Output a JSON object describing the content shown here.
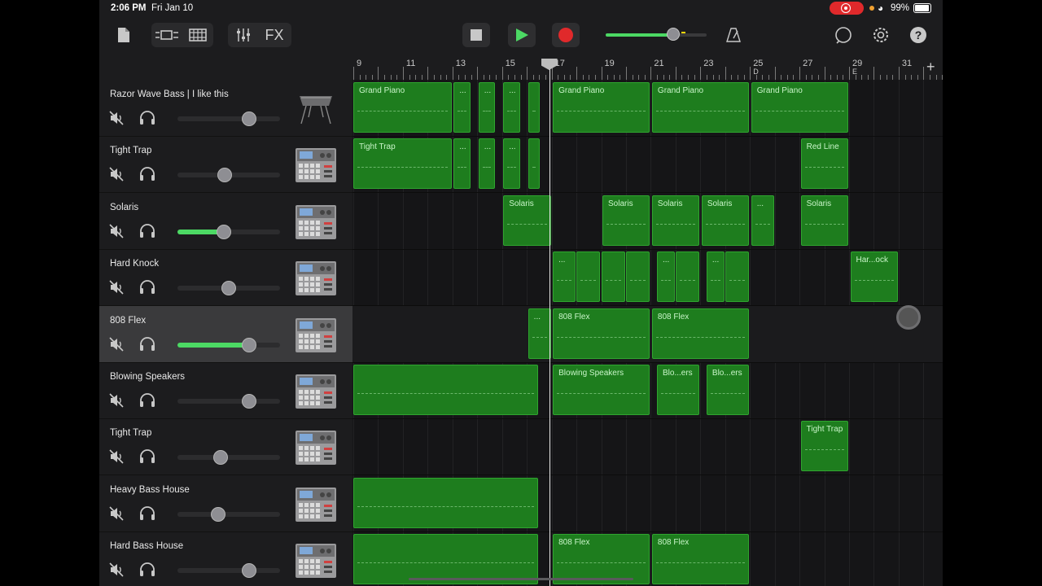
{
  "status_bar": {
    "time": "2:06 PM",
    "date": "Fri Jan 10",
    "battery": "99%"
  },
  "toolbar": {
    "fx_label": "FX",
    "master_volume": 0.42,
    "icons": [
      "document-icon",
      "track-view-icon",
      "live-loops-icon",
      "mixer-icon",
      "stop-icon",
      "play-icon",
      "record-icon",
      "metronome-icon",
      "loop-browser-icon",
      "settings-icon",
      "help-icon"
    ]
  },
  "ruler": {
    "bars": [
      "9",
      "11",
      "13",
      "15",
      "17",
      "19",
      "21",
      "23",
      "25",
      "27",
      "29",
      "31"
    ],
    "markers": [
      "D",
      "E"
    ]
  },
  "tracks": [
    {
      "name": "Razor Wave Bass | I like this",
      "volume": 0.7,
      "active": false,
      "instrument": "keyboard-icon"
    },
    {
      "name": "Tight Trap",
      "volume": 0.46,
      "active": false,
      "instrument": "drum-machine-icon"
    },
    {
      "name": "Solaris",
      "volume": 0.45,
      "active": true,
      "instrument": "drum-machine-icon"
    },
    {
      "name": "Hard Knock",
      "volume": 0.5,
      "active": false,
      "instrument": "drum-machine-icon"
    },
    {
      "name": "808 Flex",
      "volume": 0.7,
      "active": true,
      "selected": true,
      "instrument": "drum-machine-icon"
    },
    {
      "name": "Blowing Speakers",
      "volume": 0.7,
      "active": false,
      "instrument": "drum-machine-icon"
    },
    {
      "name": "Tight Trap",
      "volume": 0.42,
      "active": false,
      "instrument": "drum-machine-icon"
    },
    {
      "name": "Heavy Bass House",
      "volume": 0.4,
      "active": false,
      "instrument": "drum-machine-icon"
    },
    {
      "name": "Hard Bass House",
      "volume": 0.7,
      "active": false,
      "instrument": "drum-machine-icon"
    }
  ],
  "regions": [
    {
      "track": 0,
      "start": 9.0,
      "end": 13.0,
      "label": "Grand Piano"
    },
    {
      "track": 0,
      "start": 13.05,
      "end": 13.75,
      "label": "..."
    },
    {
      "track": 0,
      "start": 14.05,
      "end": 14.75,
      "label": "..."
    },
    {
      "track": 0,
      "start": 15.05,
      "end": 15.75,
      "label": "..."
    },
    {
      "track": 0,
      "start": 16.05,
      "end": 16.55,
      "label": ""
    },
    {
      "track": 0,
      "start": 17.05,
      "end": 21.0,
      "label": "Grand Piano"
    },
    {
      "track": 0,
      "start": 21.05,
      "end": 25.0,
      "label": "Grand Piano"
    },
    {
      "track": 0,
      "start": 25.05,
      "end": 29.0,
      "label": "Grand Piano"
    },
    {
      "track": 1,
      "start": 9.0,
      "end": 13.0,
      "label": "Tight Trap"
    },
    {
      "track": 1,
      "start": 13.05,
      "end": 13.75,
      "label": "..."
    },
    {
      "track": 1,
      "start": 14.05,
      "end": 14.75,
      "label": "..."
    },
    {
      "track": 1,
      "start": 15.05,
      "end": 15.75,
      "label": "..."
    },
    {
      "track": 1,
      "start": 16.05,
      "end": 16.55,
      "label": ""
    },
    {
      "track": 1,
      "start": 27.05,
      "end": 29.0,
      "label": "Red Line"
    },
    {
      "track": 2,
      "start": 15.05,
      "end": 17.0,
      "label": "Solaris"
    },
    {
      "track": 2,
      "start": 19.05,
      "end": 21.0,
      "label": "Solaris"
    },
    {
      "track": 2,
      "start": 21.05,
      "end": 23.0,
      "label": "Solaris"
    },
    {
      "track": 2,
      "start": 23.05,
      "end": 25.0,
      "label": "Solaris"
    },
    {
      "track": 2,
      "start": 25.05,
      "end": 26.0,
      "label": "..."
    },
    {
      "track": 2,
      "start": 27.05,
      "end": 29.0,
      "label": "Solaris"
    },
    {
      "track": 3,
      "start": 17.05,
      "end": 18.0,
      "label": "..."
    },
    {
      "track": 3,
      "start": 18.0,
      "end": 19.0,
      "label": ""
    },
    {
      "track": 3,
      "start": 19.0,
      "end": 20.0,
      "label": ""
    },
    {
      "track": 3,
      "start": 20.0,
      "end": 21.0,
      "label": ""
    },
    {
      "track": 3,
      "start": 21.25,
      "end": 22.0,
      "label": "..."
    },
    {
      "track": 3,
      "start": 22.0,
      "end": 23.0,
      "label": ""
    },
    {
      "track": 3,
      "start": 23.25,
      "end": 24.0,
      "label": "..."
    },
    {
      "track": 3,
      "start": 24.0,
      "end": 25.0,
      "label": ""
    },
    {
      "track": 3,
      "start": 29.05,
      "end": 31.0,
      "label": "Har...ock"
    },
    {
      "track": 4,
      "start": 16.05,
      "end": 17.0,
      "label": "..."
    },
    {
      "track": 4,
      "start": 17.05,
      "end": 21.0,
      "label": "808 Flex"
    },
    {
      "track": 4,
      "start": 21.05,
      "end": 25.0,
      "label": "808 Flex"
    },
    {
      "track": 5,
      "start": 9.0,
      "end": 16.5,
      "label": ""
    },
    {
      "track": 5,
      "start": 17.05,
      "end": 21.0,
      "label": "Blowing Speakers"
    },
    {
      "track": 5,
      "start": 21.25,
      "end": 23.0,
      "label": "Blo...ers"
    },
    {
      "track": 5,
      "start": 23.25,
      "end": 25.0,
      "label": "Blo...ers"
    },
    {
      "track": 6,
      "start": 27.05,
      "end": 29.0,
      "label": "Tight Trap"
    },
    {
      "track": 7,
      "start": 9.0,
      "end": 16.5,
      "label": ""
    },
    {
      "track": 8,
      "start": 9.0,
      "end": 16.5,
      "label": ""
    },
    {
      "track": 8,
      "start": 17.05,
      "end": 21.0,
      "label": "808 Flex"
    },
    {
      "track": 8,
      "start": 21.05,
      "end": 25.0,
      "label": "808 Flex"
    }
  ],
  "playhead_bar": 16.9,
  "colors": {
    "region": "#1e7d1e",
    "region_border": "#2fa52f",
    "accent": "#4cd964",
    "record": "#e0292b"
  }
}
